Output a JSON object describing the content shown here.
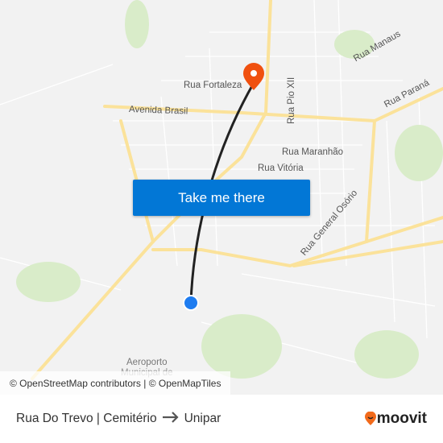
{
  "map": {
    "labels": {
      "rua_fortaleza": "Rua Fortaleza",
      "avenida_brasil": "Avenida Brasil",
      "rua_pio_xii": "Rua Pio XII",
      "rua_manaus": "Rua Manaus",
      "rua_parana": "Rua Paraná",
      "rua_maranhao": "Rua Maranhão",
      "rua_vitoria": "Rua Vitória",
      "rua_general_osorio": "Rua General Osório",
      "aeroporto": "Aeroporto",
      "municipal": "Municipal de"
    },
    "take_me_there": "Take me there",
    "attribution": "© OpenStreetMap contributors | © OpenMapTiles",
    "colors": {
      "destination_pin": "#f0500f",
      "origin_dot": "#1e7cf0",
      "button": "#0277d6",
      "major_road": "#fbe29a"
    }
  },
  "footer": {
    "origin": "Rua Do Trevo | Cemitério",
    "destination": "Unipar",
    "arrow_icon": "arrow-right-icon",
    "brand": "moovit"
  }
}
